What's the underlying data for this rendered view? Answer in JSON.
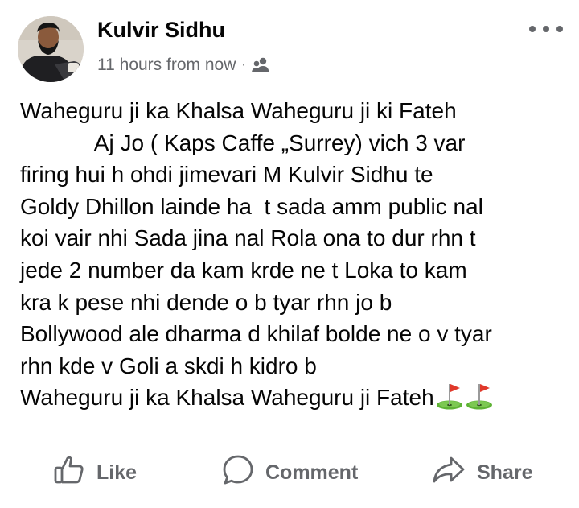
{
  "post": {
    "author": "Kulvir Sidhu",
    "timestamp": "11 hours from now",
    "separator": "·",
    "audience_icon": "friends-icon",
    "more_icon": "more-options-icon",
    "lines": [
      "Waheguru ji ka Khalsa Waheguru ji ki Fateh",
      "            Aj Jo ( Kaps Caffe „Surrey) vich 3 var",
      "firing hui h ohdi jimevari M Kulvir Sidhu te",
      "Goldy Dhillon lainde ha  t sada amm public nal",
      "koi vair nhi Sada jina nal Rola ona to dur rhn t",
      "jede 2 number da kam krde ne t Loka to kam",
      "kra k pese nhi dende o b tyar rhn jo b",
      "Bollywood ale dharma d khilaf bolde ne o v tyar",
      "rhn kde v Goli a skdi h kidro b",
      "Waheguru ji ka Khalsa Waheguru ji Fateh"
    ],
    "trailing_emoji": [
      "golf-flag-emoji",
      "golf-flag-emoji"
    ]
  },
  "actions": {
    "like_label": "Like",
    "comment_label": "Comment",
    "share_label": "Share",
    "like_icon": "thumbs-up-icon",
    "comment_icon": "speech-bubble-icon",
    "share_icon": "share-arrow-icon"
  },
  "colors": {
    "text_primary": "#050505",
    "text_secondary": "#65676b",
    "background": "#ffffff",
    "flag_red": "#e0392b",
    "grass_green": "#5fb336"
  }
}
